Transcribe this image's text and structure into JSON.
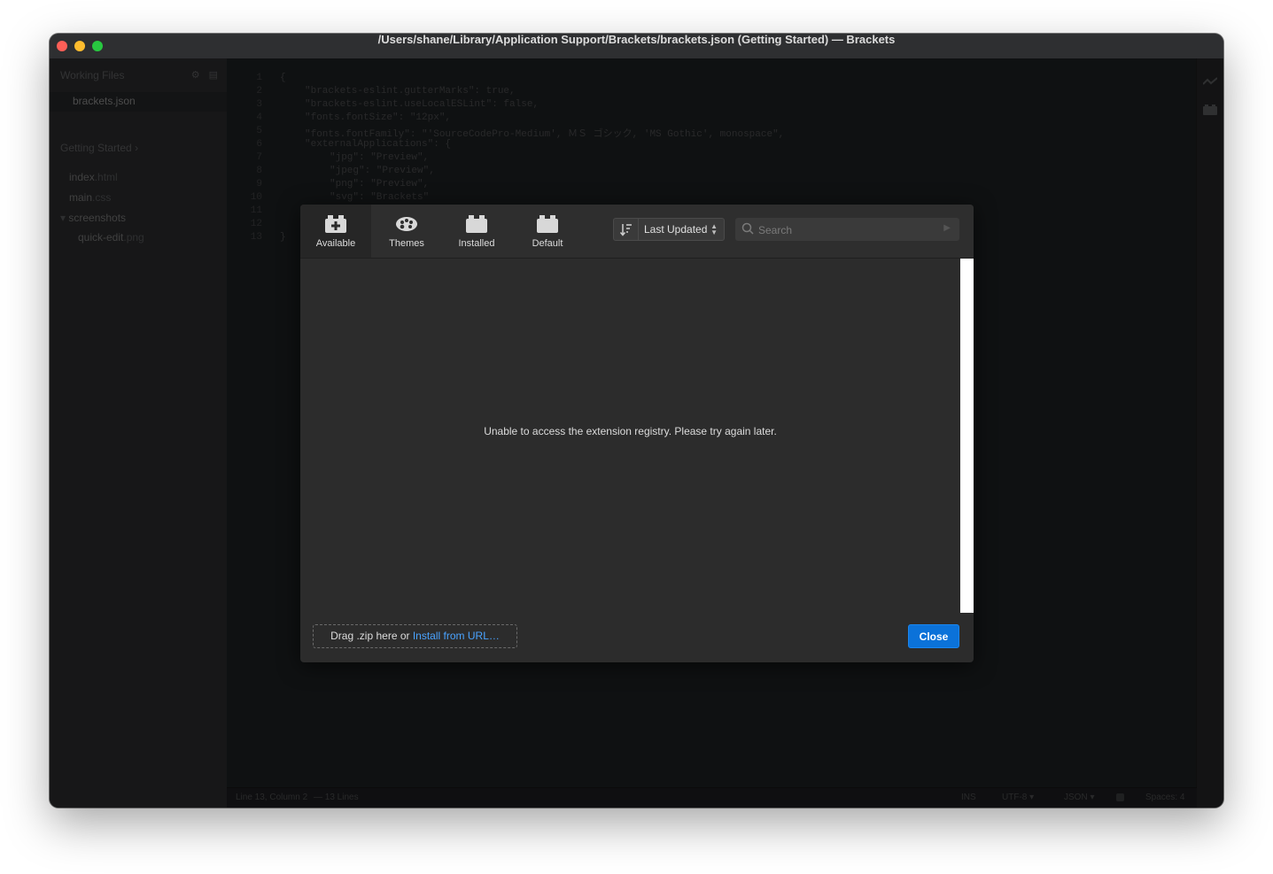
{
  "window": {
    "title": "/Users/shane/Library/Application Support/Brackets/brackets.json (Getting Started) — Brackets"
  },
  "sidebar": {
    "working_files_title": "Working Files",
    "working_files": [
      "brackets.json"
    ],
    "project_title": "Getting Started",
    "project_caret": "›",
    "tree": [
      {
        "name": "index",
        "ext": ".html"
      },
      {
        "name": "main",
        "ext": ".css"
      },
      {
        "name": "screenshots",
        "ext": ""
      },
      {
        "name": "quick-edit",
        "ext": ".png"
      }
    ]
  },
  "editor": {
    "lines": [
      {
        "n": "1",
        "text": "{"
      },
      {
        "n": "2",
        "text": "\"brackets-eslint.gutterMarks\": true,"
      },
      {
        "n": "3",
        "text": "\"brackets-eslint.useLocalESLint\": false,"
      },
      {
        "n": "4",
        "text": "\"fonts.fontSize\": \"12px\","
      },
      {
        "n": "5",
        "text": "\"fonts.fontFamily\": \"'SourceCodePro-Medium', ＭＳ ゴシック, 'MS Gothic', monospace\","
      },
      {
        "n": "6",
        "text": "\"externalApplications\": {"
      },
      {
        "n": "7",
        "text": "\"jpg\": \"Preview\","
      },
      {
        "n": "8",
        "text": "\"jpeg\": \"Preview\","
      },
      {
        "n": "9",
        "text": "\"png\": \"Preview\","
      },
      {
        "n": "10",
        "text": "\"svg\": \"Brackets\""
      },
      {
        "n": "11",
        "text": ""
      },
      {
        "n": "12",
        "text": ""
      },
      {
        "n": "13",
        "text": "}"
      }
    ]
  },
  "statusbar": {
    "position": "Line 13, Column 2",
    "lines": "— 13 Lines",
    "mode": "INS",
    "encoding": "UTF-8",
    "language": "JSON",
    "spaces": "Spaces: 4"
  },
  "extension_manager": {
    "tabs": [
      {
        "label": "Available",
        "icon": "plus-package-icon",
        "active": true
      },
      {
        "label": "Themes",
        "icon": "palette-icon",
        "active": false
      },
      {
        "label": "Installed",
        "icon": "package-icon",
        "active": false
      },
      {
        "label": "Default",
        "icon": "package-icon",
        "active": false
      }
    ],
    "sort_label": "Last Updated",
    "search_placeholder": "Search",
    "message": "Unable to access the extension registry. Please try again later.",
    "drop_text": "Drag .zip here or ",
    "install_link": "Install from URL…",
    "close_label": "Close"
  }
}
